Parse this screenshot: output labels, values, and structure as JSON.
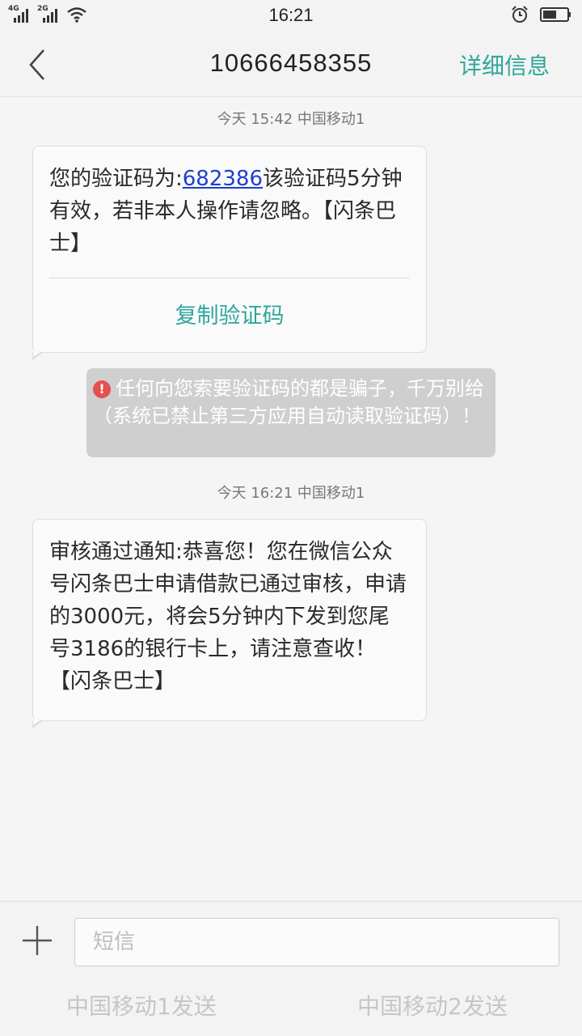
{
  "status_bar": {
    "sim1_label": "4G",
    "sim2_label": "2G",
    "time": "16:21",
    "icons": [
      "signal-icon",
      "signal-icon",
      "wifi-icon",
      "alarm-icon",
      "battery-icon"
    ]
  },
  "header": {
    "title": "10666458355",
    "details_label": "详细信息"
  },
  "messages": [
    {
      "timestamp": "今天  15:42  中国移动1",
      "text_before": "您的验证码为:",
      "code": "682386",
      "text_after": "该验证码5分钟有效，若非本人操作请忽略。【闪条巴士】",
      "action_label": "复制验证码"
    },
    {
      "timestamp": "今天  16:21  中国移动1",
      "text": "审核通过通知:恭喜您！您在微信公众号闪条巴士申请借款已通过审核，申请的3000元，将会5分钟内下发到您尾号3186的银行卡上，请注意查收！【闪条巴士】"
    }
  ],
  "warning": {
    "icon_glyph": "!",
    "text": "任何向您索要验证码的都是骗子，千万别给（系统已禁止第三方应用自动读取验证码）！"
  },
  "composer": {
    "placeholder": "短信",
    "send_sim1": "中国移动1发送",
    "send_sim2": "中国移动2发送"
  },
  "colors": {
    "accent": "#2fa69d",
    "link": "#1c3fd0",
    "warning_bg": "#cfcfcf",
    "warning_icon": "#e45050"
  }
}
